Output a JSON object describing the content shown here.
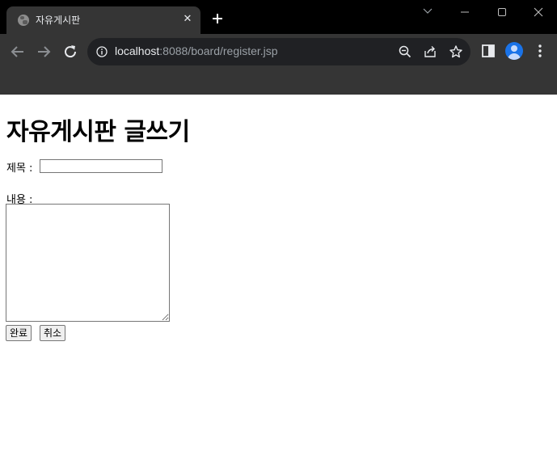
{
  "browser": {
    "tab": {
      "title": "자유게시판",
      "close_symbol": "✕",
      "favicon": "globe-icon"
    },
    "new_tab_symbol": "+",
    "window_controls": [
      "chevron-down-icon",
      "minimize-icon",
      "maximize-icon",
      "close-icon"
    ],
    "address_bar": {
      "host": "localhost",
      "rest": ":8088/board/register.jsp"
    },
    "toolbar_icons": [
      "zoom-out-icon",
      "share-icon",
      "bookmark-star-icon",
      "side-panel-icon",
      "profile-avatar",
      "more-menu-icon"
    ],
    "colors": {
      "frame": "#000000",
      "toolbar": "#353535",
      "omnibox": "#202124",
      "accent": "#1a73e8"
    }
  },
  "page": {
    "heading": "자유게시판 글쓰기",
    "form": {
      "title_label": "제목 :",
      "title_value": "",
      "content_label": "내용 :",
      "content_value": "",
      "submit_label": "완료",
      "cancel_label": "취소"
    }
  }
}
